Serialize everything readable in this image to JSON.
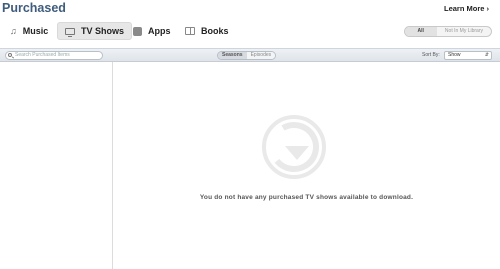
{
  "header": {
    "title": "Purchased",
    "learn_more": "Learn More ›"
  },
  "media_tabs": [
    {
      "label": "Music",
      "icon": "music-note-icon",
      "selected": false
    },
    {
      "label": "TV Shows",
      "icon": "tv-icon",
      "selected": true
    },
    {
      "label": "Apps",
      "icon": "apps-icon",
      "selected": false
    },
    {
      "label": "Books",
      "icon": "books-icon",
      "selected": false
    }
  ],
  "filter": {
    "all": "All",
    "not_in_library": "Not In My Library",
    "selected": "All"
  },
  "toolbar": {
    "search_placeholder": "Search Purchased Items",
    "view_modes": [
      "Seasons",
      "Episodes"
    ],
    "active_view": "Seasons",
    "sort_label": "Sort By:",
    "sort_value": "Show"
  },
  "main": {
    "empty_message": "You do not have any purchased TV shows available to download."
  },
  "colors": {
    "title": "#3f5c7d",
    "icon": "#e9e9e9"
  }
}
